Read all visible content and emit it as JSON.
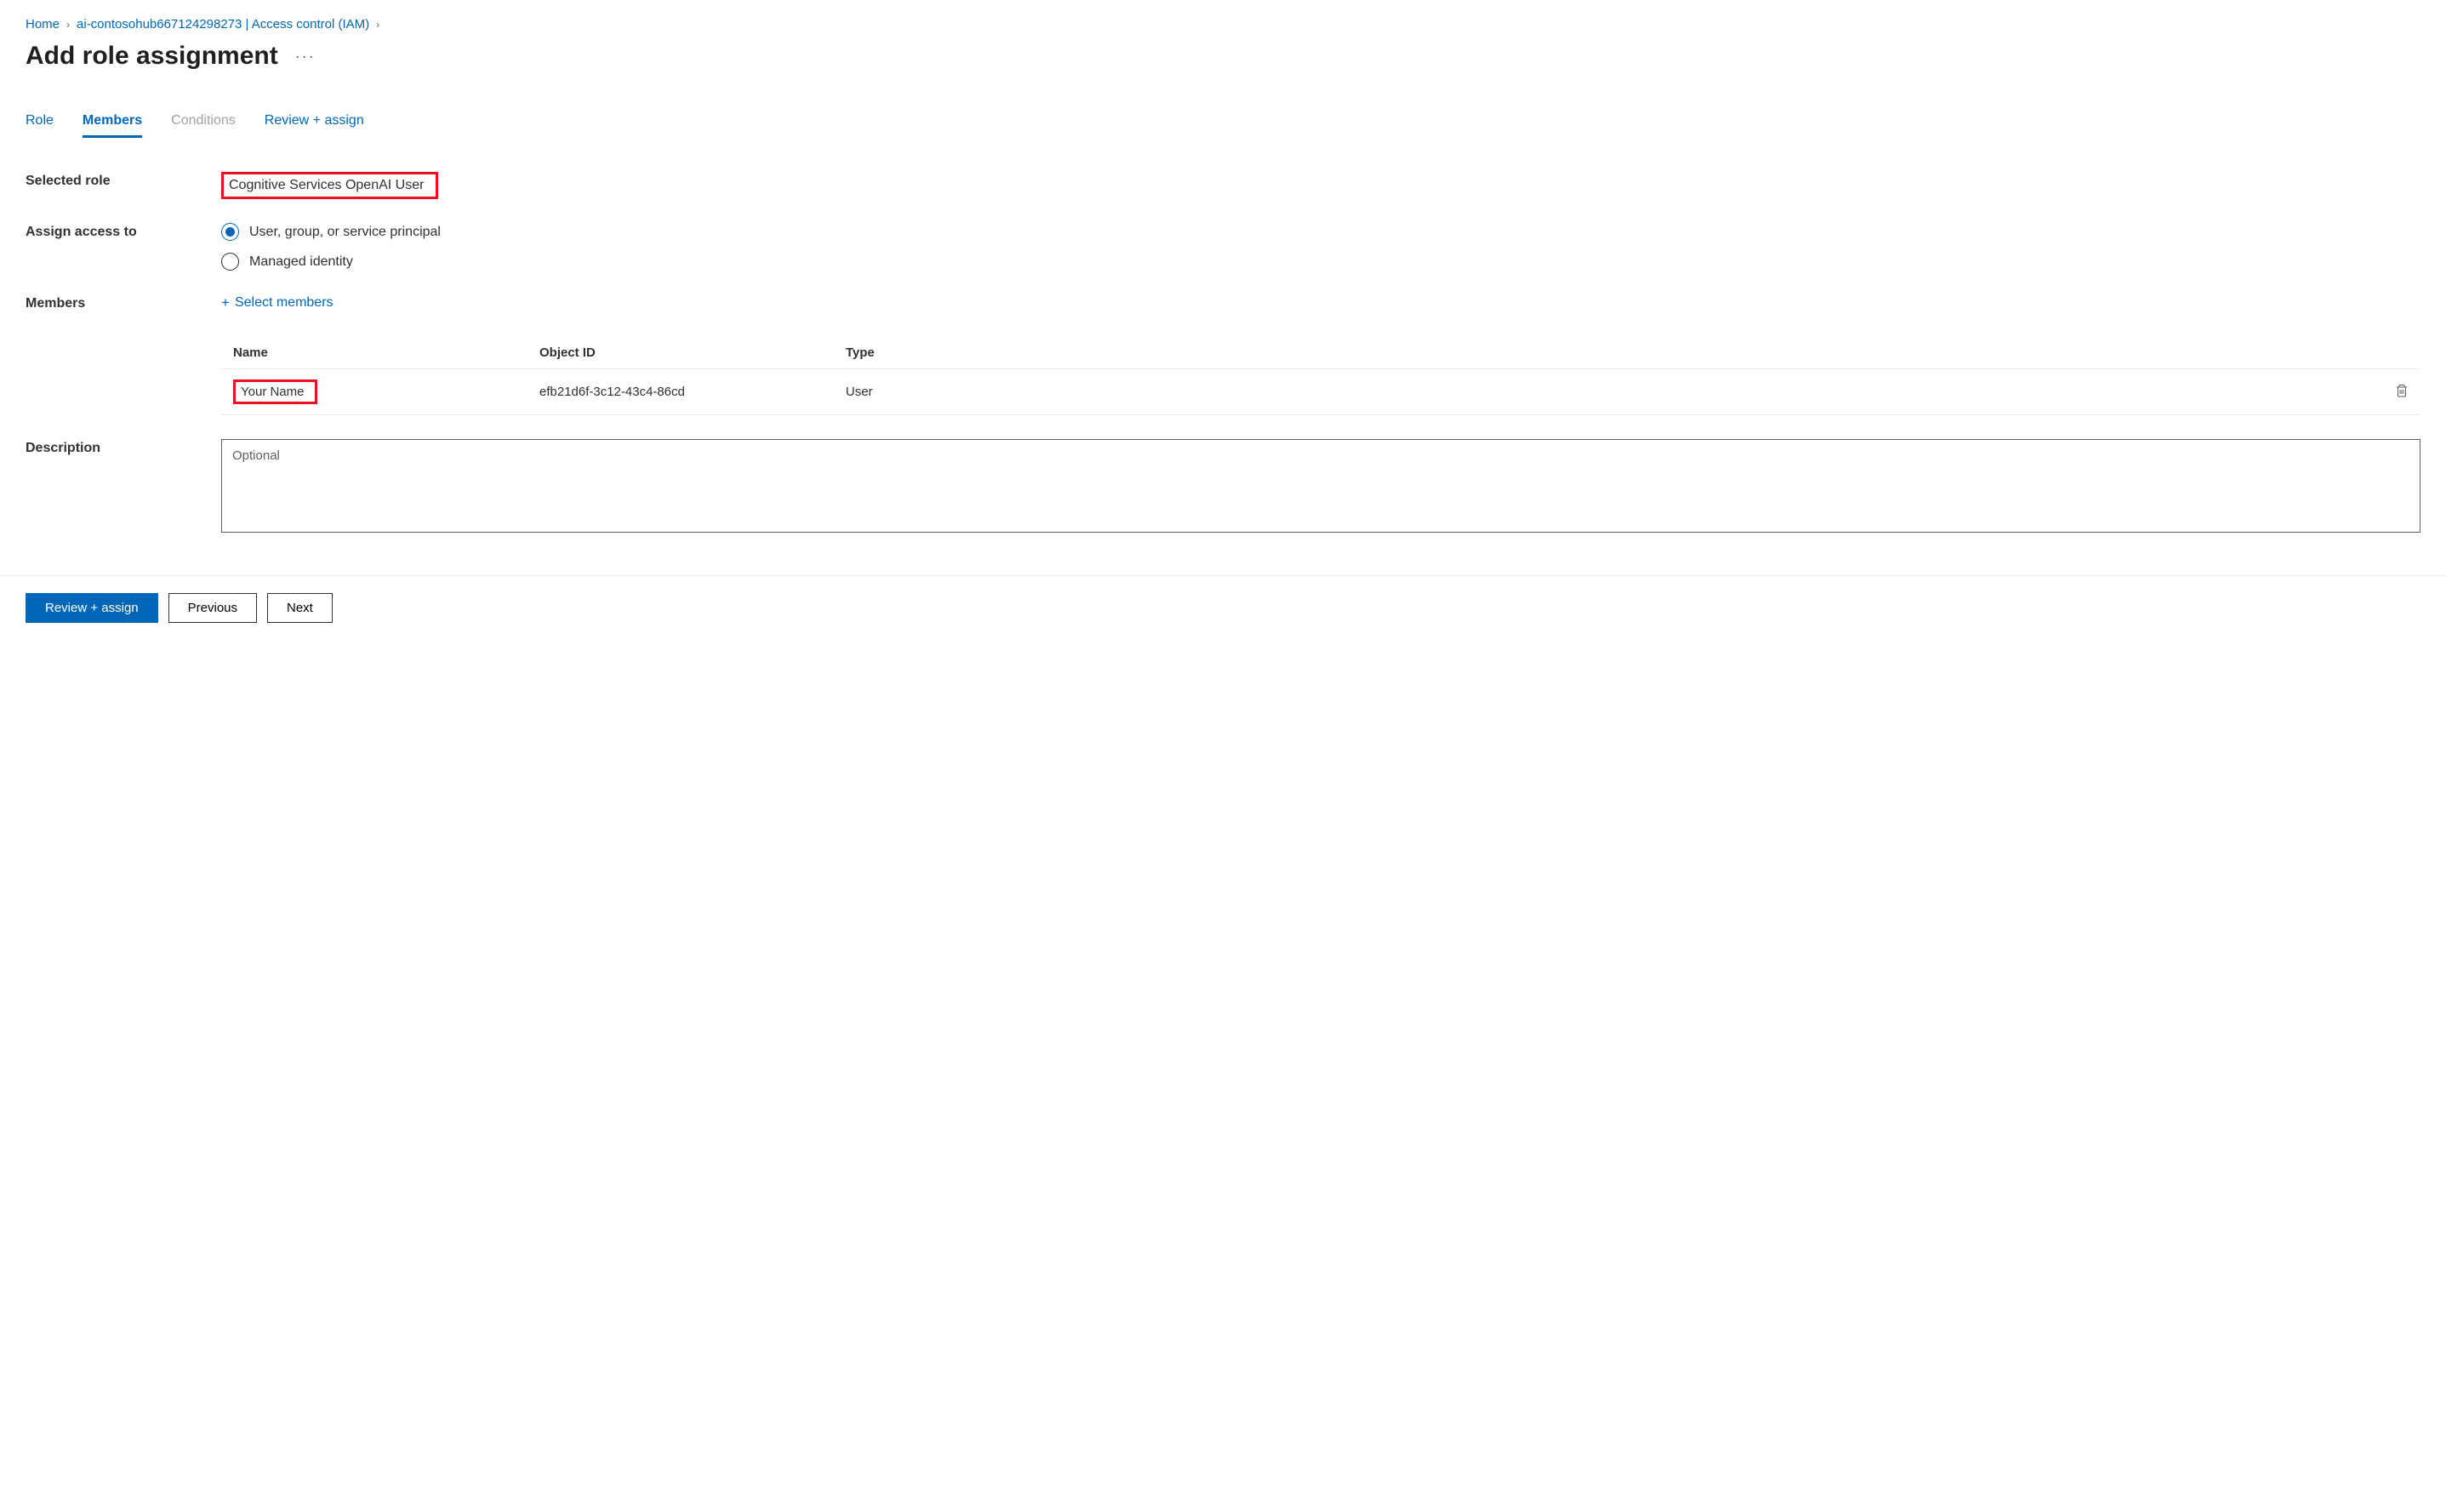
{
  "breadcrumb": {
    "home": "Home",
    "resource": "ai-contosohub667124298273 | Access control (IAM)"
  },
  "page_title": "Add role assignment",
  "tabs": {
    "role": "Role",
    "members": "Members",
    "conditions": "Conditions",
    "review": "Review + assign"
  },
  "labels": {
    "selected_role": "Selected role",
    "assign_access_to": "Assign access to",
    "members": "Members",
    "description": "Description"
  },
  "selected_role_value": "Cognitive Services OpenAI User",
  "radio": {
    "user_group": "User, group, or service principal",
    "managed_identity": "Managed identity"
  },
  "select_members_label": "Select members",
  "table": {
    "headers": {
      "name": "Name",
      "object_id": "Object ID",
      "type": "Type"
    },
    "rows": [
      {
        "name": "Your Name",
        "object_id": "efb21d6f-3c12-43c4-86cd",
        "type": "User"
      }
    ]
  },
  "description_placeholder": "Optional",
  "footer": {
    "review": "Review + assign",
    "previous": "Previous",
    "next": "Next"
  }
}
